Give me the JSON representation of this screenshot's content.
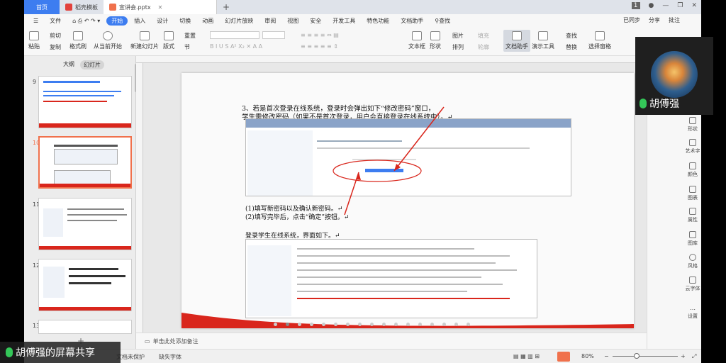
{
  "tabs": {
    "home": "首页",
    "template": "稻壳模板",
    "doc": "宣讲会.pptx"
  },
  "window_badge": "1",
  "menu": [
    "文件",
    "开始",
    "插入",
    "设计",
    "切换",
    "动画",
    "幻灯片放映",
    "审阅",
    "视图",
    "安全",
    "开发工具",
    "特色功能",
    "文档助手"
  ],
  "menu_search": "查找",
  "menu_right": [
    "已同步",
    "分享",
    "批注"
  ],
  "ribbon": {
    "paste": "粘贴",
    "cut": "剪切",
    "copy": "复制",
    "format_painter": "格式刷",
    "play_from_current": "从当前开始",
    "new_slide": "新建幻灯片",
    "layout": "版式",
    "section": "节",
    "reset": "重置",
    "textbox": "文本框",
    "shape": "形状",
    "arrange": "排列",
    "outline": "轮廓",
    "picture": "图片",
    "fill": "填充",
    "doc_helper": "文档助手",
    "presenter_tools": "演示工具",
    "find": "查找",
    "replace": "替换",
    "select_pane": "选择窗格"
  },
  "panel": {
    "tab_outline": "大纲",
    "tab_slides": "幻灯片",
    "slide_numbers": [
      "9",
      "10",
      "11",
      "12",
      "13"
    ]
  },
  "slide": {
    "title_line1": "3、若是首次登录在线系统，登录时会弹出如下“修改密码”窗口，",
    "title_line2": "学生需修改密码（如果不是首次登录，用户会直接登录在线系统中）。↵",
    "step1": "(1)填写新密码以及确认新密码。↵",
    "step2": "(2)填写完毕后，点击“确定”按钮。↵",
    "login_line": "登录学生在线系统，界面如下。↵"
  },
  "notes_placeholder": "单击此处添加备注",
  "status": {
    "doc_protect": "文档未保护",
    "missing_font": "缺失字体",
    "zoom": "80%"
  },
  "right_tools": [
    "形状",
    "艺术字",
    "颜色",
    "图表",
    "属性",
    "图库",
    "风格",
    "云字体",
    "设置"
  ],
  "video": {
    "name": "胡傅强"
  },
  "share_label": "胡傅强的屏幕共享",
  "colors": {
    "accent": "#3d7df0",
    "slide_accent": "#d9261c",
    "play": "#f0714c",
    "mic": "#34c759"
  }
}
